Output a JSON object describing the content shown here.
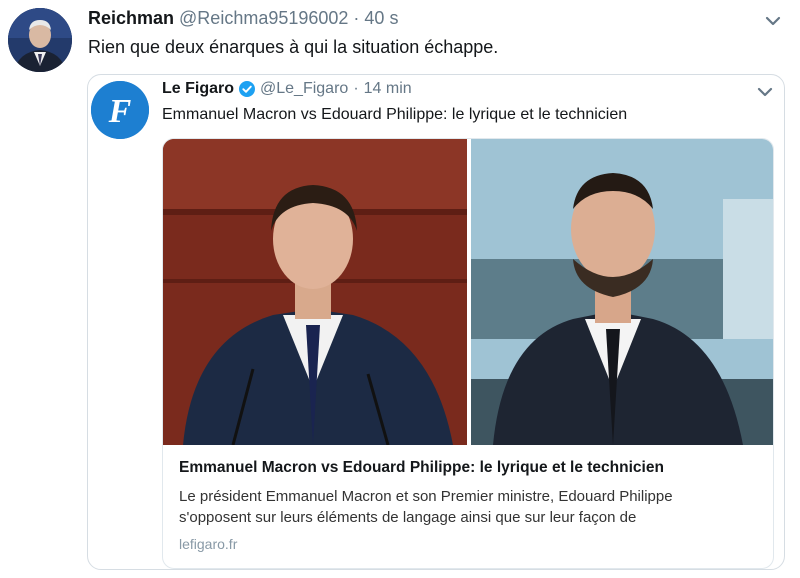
{
  "tweet": {
    "display_name": "Reichman",
    "handle": "@Reichma95196002",
    "separator": "·",
    "time": "40 s",
    "text": "Rien que deux énarques à qui la situation échappe.",
    "more_icon": "chevron-down-icon"
  },
  "quoted": {
    "display_name": "Le Figaro",
    "verified_icon": "verified-badge-icon",
    "handle": "@Le_Figaro",
    "separator": "·",
    "time": "14 min",
    "text": "Emmanuel Macron vs Edouard Philippe: le lyrique et le technicien",
    "avatar_letter": "F",
    "more_icon": "chevron-down-icon",
    "card": {
      "title": "Emmanuel Macron vs Edouard Philippe: le lyrique et le technicien",
      "description_line1": "Le président Emmanuel Macron et son Premier ministre, Edouard Philippe",
      "description_line2": "s'opposent sur leurs éléments de langage ainsi que sur leur façon de",
      "domain": "lefigaro.fr"
    }
  },
  "colors": {
    "figaro_blue": "#1d7fd1",
    "verified_blue": "#1da1f2",
    "muted_text": "#657786",
    "border": "#d6dde3"
  }
}
